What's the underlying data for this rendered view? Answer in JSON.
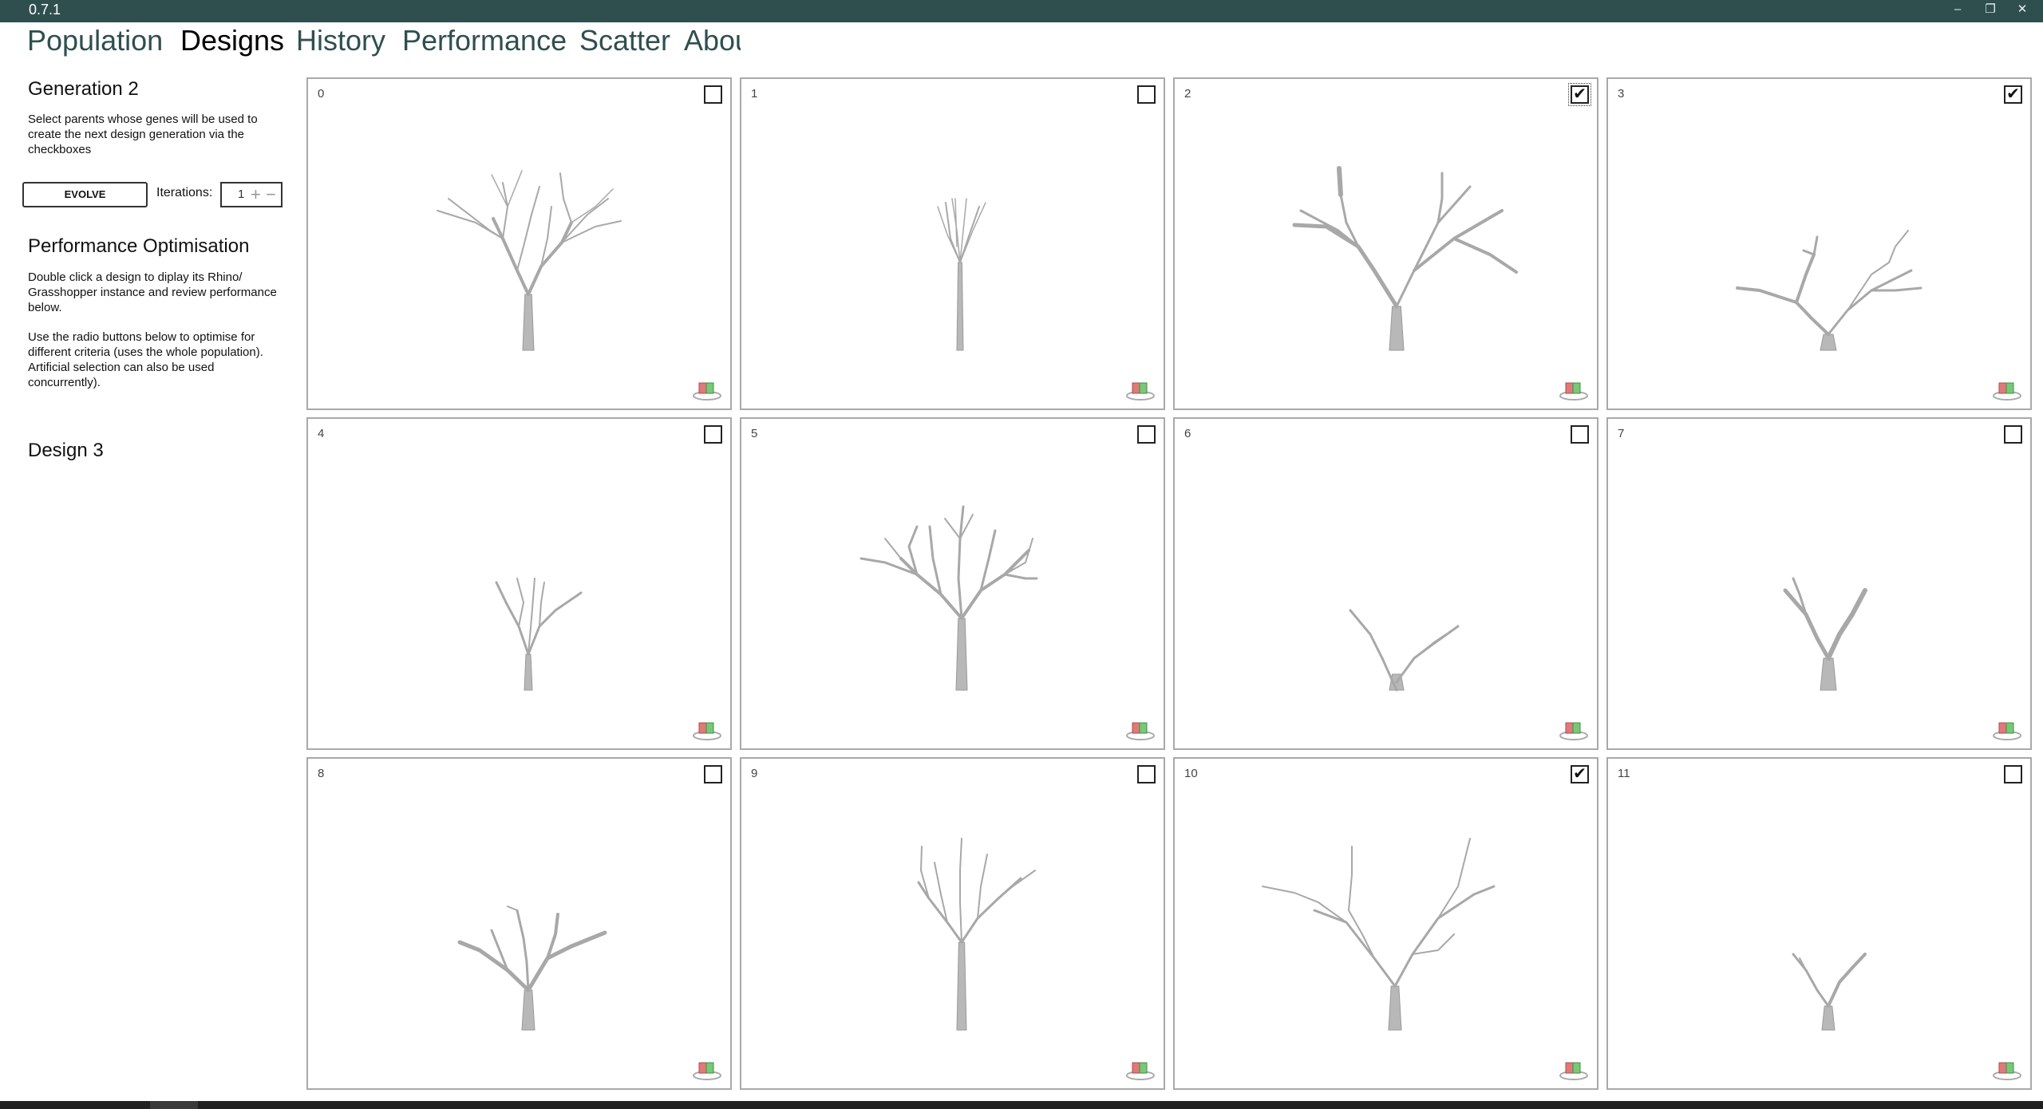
{
  "app": {
    "version": "0.7.1",
    "window_controls": [
      {
        "name": "minimize-button",
        "glyph": "–"
      },
      {
        "name": "restore-button",
        "glyph": "❐"
      },
      {
        "name": "close-button",
        "glyph": "✕"
      }
    ]
  },
  "nav": {
    "tabs": [
      {
        "label": "Population",
        "active": false
      },
      {
        "label": "Designs",
        "active": true
      },
      {
        "label": "History",
        "active": false
      },
      {
        "label": "Performance",
        "active": false
      },
      {
        "label": "Scatter",
        "active": false
      },
      {
        "label": "About",
        "active": false
      }
    ]
  },
  "sidebar": {
    "generation_title": "Generation 2",
    "generation_desc": "Select parents whose genes will be used to create the next design generation via the checkboxes",
    "evolve_label": "EVOLVE",
    "iterations_label": "Iterations:",
    "iterations_value": "1",
    "perf_title": "Performance Optimisation",
    "perf_desc1": "Double click a design to diplay its Rhino/ Grasshopper instance and review performance below.",
    "perf_desc2": "Use the radio buttons below to optimise for different criteria (uses the whole population). Artificial selection can also be used concurrently).",
    "design_title": "Design 3"
  },
  "designs": [
    {
      "index": "0",
      "checked": false
    },
    {
      "index": "1",
      "checked": false
    },
    {
      "index": "2",
      "checked": true,
      "focused": true
    },
    {
      "index": "3",
      "checked": true
    },
    {
      "index": "4",
      "checked": false
    },
    {
      "index": "5",
      "checked": false
    },
    {
      "index": "6",
      "checked": false
    },
    {
      "index": "7",
      "checked": false
    },
    {
      "index": "8",
      "checked": false
    },
    {
      "index": "9",
      "checked": false
    },
    {
      "index": "10",
      "checked": true
    },
    {
      "index": "11",
      "checked": false
    }
  ],
  "colors": {
    "titlebar": "#2f4f4f",
    "nav_inactive": "#2f4f4f",
    "card_border": "#a9a9a9",
    "tree_stroke": "#9a9a9a"
  },
  "icons": {
    "card_badge": "grasshopper-icon"
  }
}
